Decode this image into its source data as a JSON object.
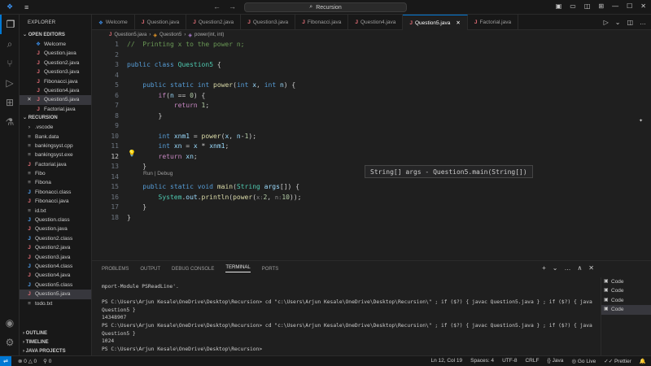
{
  "titlebar": {
    "search_text": "Recursion"
  },
  "sidebar": {
    "title": "EXPLORER",
    "open_editors_label": "OPEN EDITORS",
    "open_editors": [
      {
        "label": "Welcome",
        "type": "vscode"
      },
      {
        "label": "Question.java",
        "type": "java"
      },
      {
        "label": "Question2.java",
        "type": "java"
      },
      {
        "label": "Question3.java",
        "type": "java"
      },
      {
        "label": "Fibonacci.java",
        "type": "java"
      },
      {
        "label": "Question4.java",
        "type": "java"
      },
      {
        "label": "Question5.java",
        "type": "java",
        "selected": true
      },
      {
        "label": "Factorial.java",
        "type": "java"
      }
    ],
    "folder_label": "RECURSION",
    "files": [
      {
        "label": ".vscode",
        "type": "folder"
      },
      {
        "label": "Bank.data",
        "type": "file"
      },
      {
        "label": "bankingsyst.cpp",
        "type": "file"
      },
      {
        "label": "bankingsyst.exe",
        "type": "file"
      },
      {
        "label": "Factorial.java",
        "type": "java"
      },
      {
        "label": "Fibo",
        "type": "file"
      },
      {
        "label": "Fibona",
        "type": "file"
      },
      {
        "label": "Fibonacci.class",
        "type": "class"
      },
      {
        "label": "Fibonacci.java",
        "type": "java"
      },
      {
        "label": "id.txt",
        "type": "file"
      },
      {
        "label": "Question.class",
        "type": "class"
      },
      {
        "label": "Question.java",
        "type": "java"
      },
      {
        "label": "Question2.class",
        "type": "class"
      },
      {
        "label": "Question2.java",
        "type": "java"
      },
      {
        "label": "Question3.java",
        "type": "java"
      },
      {
        "label": "Question4.class",
        "type": "class"
      },
      {
        "label": "Question4.java",
        "type": "java"
      },
      {
        "label": "Question5.class",
        "type": "class"
      },
      {
        "label": "Question5.java",
        "type": "java",
        "selected": true
      },
      {
        "label": "todo.txt",
        "type": "file"
      }
    ],
    "outline_label": "OUTLINE",
    "timeline_label": "TIMELINE",
    "java_projects_label": "JAVA PROJECTS"
  },
  "tabs": [
    {
      "label": "Welcome",
      "type": "vscode"
    },
    {
      "label": "Question.java",
      "type": "java"
    },
    {
      "label": "Question2.java",
      "type": "java"
    },
    {
      "label": "Question3.java",
      "type": "java"
    },
    {
      "label": "Fibonacci.java",
      "type": "java"
    },
    {
      "label": "Question4.java",
      "type": "java"
    },
    {
      "label": "Question5.java",
      "type": "java",
      "active": true
    },
    {
      "label": "Factorial.java",
      "type": "java"
    }
  ],
  "breadcrumb": {
    "file": "Question5.java",
    "class": "Question5",
    "method": "power(int, int)"
  },
  "editor": {
    "line_numbers": [
      "1",
      "2",
      "3",
      "4",
      "5",
      "6",
      "7",
      "8",
      "9",
      "10",
      "11",
      "12",
      "13",
      "14",
      "15",
      "16",
      "17",
      "18"
    ],
    "current_line": "12",
    "codelens": "Run | Debug",
    "tooltip": "String[] args - Question5.main(String[])",
    "hint_x": "x:",
    "hint_n": "n:"
  },
  "panel": {
    "tabs": [
      "PROBLEMS",
      "OUTPUT",
      "DEBUG CONSOLE",
      "TERMINAL",
      "PORTS"
    ],
    "active_tab": "TERMINAL",
    "terminal_lines": [
      "mport-Module PSReadLine'.",
      "",
      "PS C:\\Users\\Arjun Kesale\\OneDrive\\Desktop\\Recursion> cd \"c:\\Users\\Arjun Kesale\\OneDrive\\Desktop\\Recursion\\\" ; if ($?) { javac Question5.java } ; if ($?) { java",
      "Question5 }",
      "14348907",
      "PS C:\\Users\\Arjun Kesale\\OneDrive\\Desktop\\Recursion> cd \"c:\\Users\\Arjun Kesale\\OneDrive\\Desktop\\Recursion\\\" ; if ($?) { javac Question5.java } ; if ($?) { java",
      "Question5 }",
      "1024",
      "PS C:\\Users\\Arjun Kesale\\OneDrive\\Desktop\\Recursion>"
    ],
    "terminals": [
      "Code",
      "Code",
      "Code",
      "Code"
    ]
  },
  "statusbar": {
    "errors": "0",
    "warnings": "0",
    "ports": "0",
    "position": "Ln 12, Col 19",
    "spaces": "Spaces: 4",
    "encoding": "UTF-8",
    "eol": "CRLF",
    "language": "Java",
    "golive": "Go Live",
    "prettier": "Prettier"
  }
}
